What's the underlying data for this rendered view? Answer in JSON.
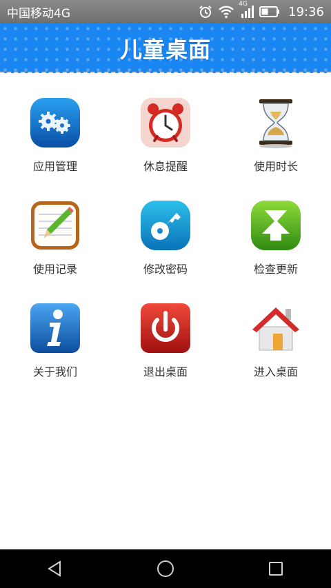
{
  "status_bar": {
    "carrier": "中国移动4G",
    "network_badge": "4G",
    "time": "19:36",
    "icons": [
      "alarm-icon",
      "wifi-icon",
      "signal-icon",
      "battery-icon"
    ]
  },
  "header": {
    "title": "儿童桌面",
    "color": "#1a86f2"
  },
  "tiles": [
    {
      "label": "应用管理",
      "icon": "gears-icon"
    },
    {
      "label": "休息提醒",
      "icon": "alarm-clock-icon"
    },
    {
      "label": "使用时长",
      "icon": "hourglass-icon"
    },
    {
      "label": "使用记录",
      "icon": "notepad-pencil-icon"
    },
    {
      "label": "修改密码",
      "icon": "key-icon"
    },
    {
      "label": "检查更新",
      "icon": "download-icon"
    },
    {
      "label": "关于我们",
      "icon": "info-icon"
    },
    {
      "label": "退出桌面",
      "icon": "power-icon"
    },
    {
      "label": "进入桌面",
      "icon": "house-icon"
    }
  ],
  "nav_bar": {
    "buttons": [
      "back-icon",
      "home-icon",
      "recents-icon"
    ]
  }
}
